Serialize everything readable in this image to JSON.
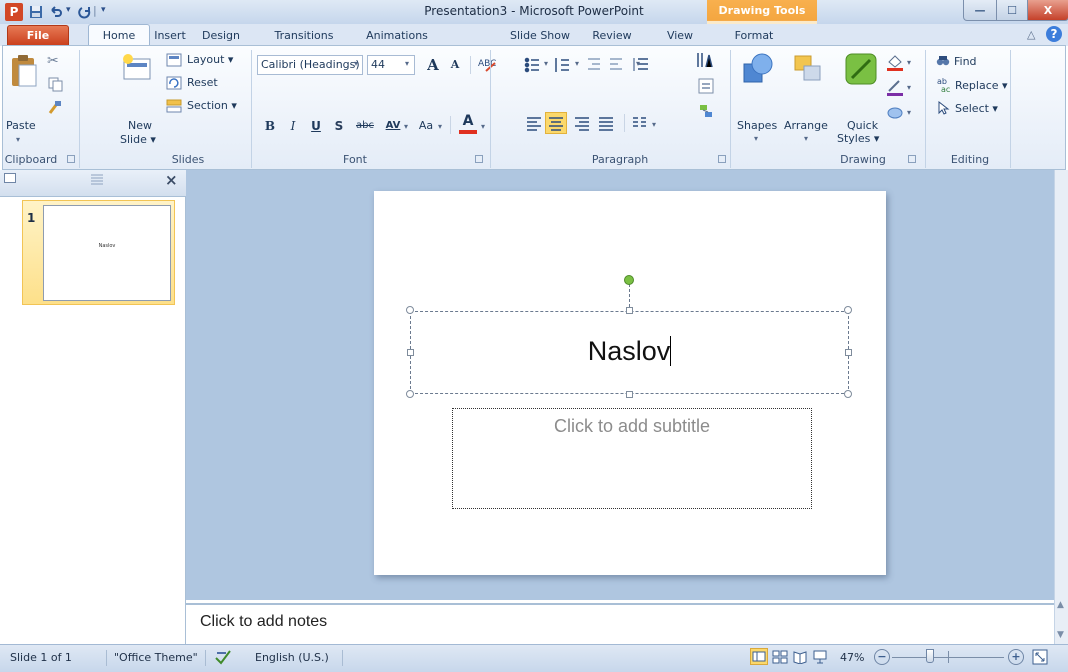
{
  "window": {
    "title": "Presentation3 - Microsoft PowerPoint",
    "contextual_tab_group": "Drawing Tools",
    "minimize_glyph": "—",
    "maximize_glyph": "☐",
    "close_glyph": "X"
  },
  "quick_access": {
    "app_icon": "P",
    "save_icon": "floppy-disk-icon",
    "undo_icon": "undo-icon",
    "redo_icon": "redo-icon",
    "separator": "|",
    "customize_glyph": "▾"
  },
  "tabs": {
    "file": "File",
    "home": "Home",
    "insert": "Insert",
    "design": "Design",
    "transitions": "Transitions",
    "animations": "Animations",
    "slide_show": "Slide Show",
    "review": "Review",
    "view": "View",
    "format": "Format",
    "help_glyph": "?",
    "minimize_ribbon_glyph": "△"
  },
  "ribbon": {
    "clipboard": {
      "group": "Clipboard",
      "paste": "Paste",
      "cut_icon": "scissors-icon",
      "copy_icon": "copy-icon",
      "format_painter_icon": "brush-icon"
    },
    "slides": {
      "group": "Slides",
      "new_slide_line1": "New",
      "new_slide_line2": "Slide ▾",
      "layout": "Layout ▾",
      "reset": "Reset",
      "section": "Section ▾"
    },
    "font": {
      "group": "Font",
      "font_name": "Calibri (Headings)",
      "font_size": "44",
      "grow": "A",
      "shrink": "A",
      "clear_format_icon": "clear-formatting-icon",
      "bold": "B",
      "italic": "I",
      "underline": "U",
      "shadow": "S",
      "strikethrough": "abc",
      "char_spacing": "AV",
      "change_case": "Aa",
      "font_color": "A"
    },
    "paragraph": {
      "group": "Paragraph",
      "bullets_glyph": "☰",
      "numbering_glyph": "☷",
      "text_direction_glyph": "⫼"
    },
    "drawing": {
      "group": "Drawing",
      "shapes": "Shapes",
      "arrange": "Arrange",
      "quick_styles_line1": "Quick",
      "quick_styles_line2": "Styles ▾"
    },
    "editing": {
      "group": "Editing",
      "find": "Find",
      "replace": "Replace ▾",
      "select": "Select ▾"
    }
  },
  "slides_pane": {
    "close_glyph": "×",
    "thumbnail_number": "1",
    "thumbnail_title": "Naslov"
  },
  "slide": {
    "title": "Naslov",
    "subtitle_placeholder": "Click to add subtitle"
  },
  "notes": {
    "placeholder": "Click to add notes"
  },
  "status": {
    "slide_position": "Slide 1 of 1",
    "theme": "\"Office Theme\"",
    "language": "English (U.S.)",
    "zoom": "47%",
    "zoom_out_glyph": "−",
    "zoom_in_glyph": "+"
  },
  "colors": {
    "file_tab": "#c93d1b",
    "contextual_tab": "#f4a640",
    "editor_background": "#afc6e0",
    "selection_handle_rotate": "#7ac043",
    "font_color_underline": "#e03020"
  }
}
